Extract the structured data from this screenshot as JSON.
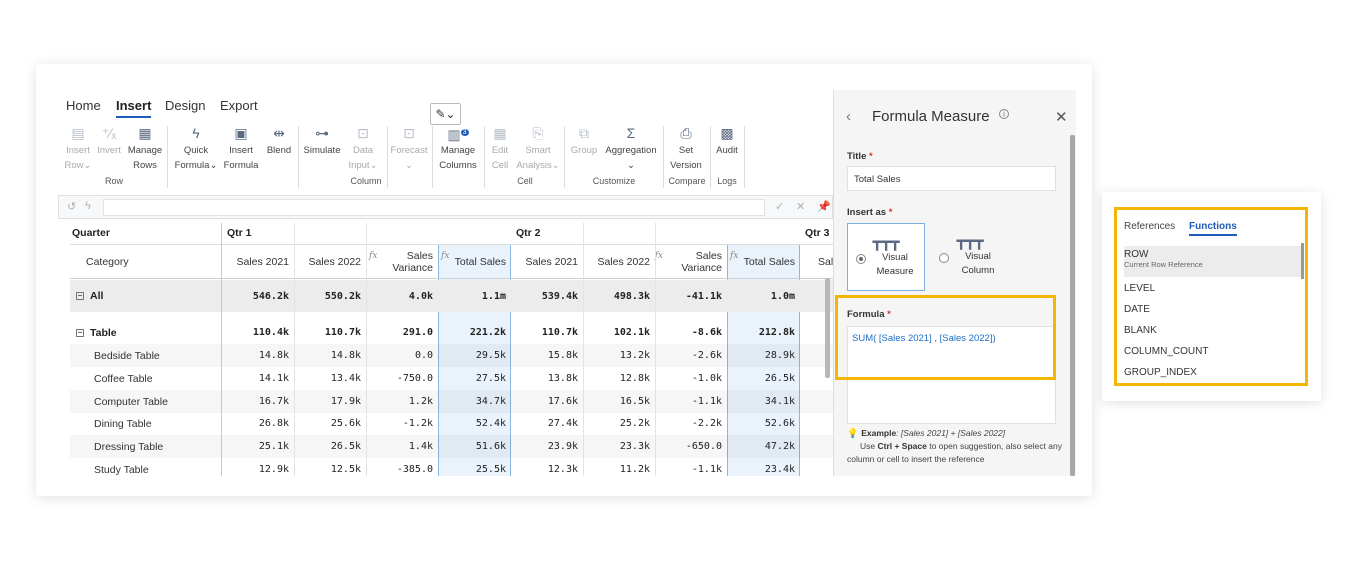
{
  "menu": {
    "tabs": [
      "Home",
      "Insert",
      "Design",
      "Export"
    ],
    "active": "Insert"
  },
  "ribbon": {
    "insert_row": [
      "Insert",
      "Row"
    ],
    "invert": "Invert",
    "manage_rows": [
      "Manage",
      "Rows"
    ],
    "group_row": "Row",
    "quick_formula": [
      "Quick",
      "Formula"
    ],
    "insert_formula": [
      "Insert",
      "Formula"
    ],
    "blend": "Blend",
    "simulate": "Simulate",
    "data_input": [
      "Data",
      "Input"
    ],
    "forecast": "Forecast",
    "group_column": "Column",
    "manage_columns": [
      "Manage",
      "Columns"
    ],
    "manage_columns_badge": "3",
    "edit_cell": [
      "Edit",
      "Cell"
    ],
    "smart_analysis": [
      "Smart",
      "Analysis"
    ],
    "group_cell": "Cell",
    "group": "Group",
    "aggregation": "Aggregation",
    "group_customize": "Customize",
    "set_version": [
      "Set",
      "Version"
    ],
    "group_compare": "Compare",
    "audit": "Audit",
    "group_logs": "Logs"
  },
  "grid": {
    "quarter_label": "Quarter",
    "category_label": "Category",
    "quarters": [
      "Qtr 1",
      "Qtr 2",
      "Qtr 3"
    ],
    "columns": [
      "Sales 2021",
      "Sales 2022",
      "Sales\nVariance",
      "Total Sales",
      "Sales 2021",
      "Sales 2022",
      "Sales\nVariance",
      "Total Sales",
      "Sal"
    ],
    "rows": [
      {
        "label": "All",
        "bold": true,
        "collapse": true,
        "values": [
          "546.2k",
          "550.2k",
          "4.0k",
          "1.1m",
          "539.4k",
          "498.3k",
          "-41.1k",
          "1.0m"
        ]
      },
      {
        "label": "Table",
        "bold": true,
        "collapse": true,
        "values": [
          "110.4k",
          "110.7k",
          "291.0",
          "221.2k",
          "110.7k",
          "102.1k",
          "-8.6k",
          "212.8k"
        ]
      },
      {
        "label": "Bedside Table",
        "values": [
          "14.8k",
          "14.8k",
          "0.0",
          "29.5k",
          "15.8k",
          "13.2k",
          "-2.6k",
          "28.9k"
        ]
      },
      {
        "label": "Coffee Table",
        "values": [
          "14.1k",
          "13.4k",
          "-750.0",
          "27.5k",
          "13.8k",
          "12.8k",
          "-1.0k",
          "26.5k"
        ]
      },
      {
        "label": "Computer Table",
        "values": [
          "16.7k",
          "17.9k",
          "1.2k",
          "34.7k",
          "17.6k",
          "16.5k",
          "-1.1k",
          "34.1k"
        ]
      },
      {
        "label": "Dining Table",
        "values": [
          "26.8k",
          "25.6k",
          "-1.2k",
          "52.4k",
          "27.4k",
          "25.2k",
          "-2.2k",
          "52.6k"
        ]
      },
      {
        "label": "Dressing Table",
        "values": [
          "25.1k",
          "26.5k",
          "1.4k",
          "51.6k",
          "23.9k",
          "23.3k",
          "-650.0",
          "47.2k"
        ]
      },
      {
        "label": "Study Table",
        "values": [
          "12.9k",
          "12.5k",
          "-385.0",
          "25.5k",
          "12.3k",
          "11.2k",
          "-1.1k",
          "23.4k"
        ]
      }
    ]
  },
  "panel": {
    "title": "Formula Measure",
    "title_label": "Title",
    "title_value": "Total Sales",
    "insert_as_label": "Insert as",
    "option_measure": [
      "Visual",
      "Measure"
    ],
    "option_column": [
      "Visual",
      "Column"
    ],
    "formula_label": "Formula",
    "formula_value": "SUM( [Sales 2021] , [Sales 2022])",
    "example_label": "Example",
    "example_value": ": [Sales 2021] + [Sales 2022]",
    "hint_pre": "Use ",
    "hint_keys": "Ctrl + Space",
    "hint_post": " to open suggestion, also select any column or cell to insert the reference"
  },
  "functions_card": {
    "tabs": [
      "References",
      "Functions"
    ],
    "active": "Functions",
    "items": [
      {
        "name": "ROW",
        "desc": "Current Row Reference"
      },
      {
        "name": "LEVEL"
      },
      {
        "name": "DATE"
      },
      {
        "name": "BLANK"
      },
      {
        "name": "COLUMN_COUNT"
      },
      {
        "name": "GROUP_INDEX"
      }
    ]
  },
  "colors": {
    "accent": "#1d5ab9",
    "highlight": "#f2b705",
    "total_col": "#eaf2fb"
  }
}
